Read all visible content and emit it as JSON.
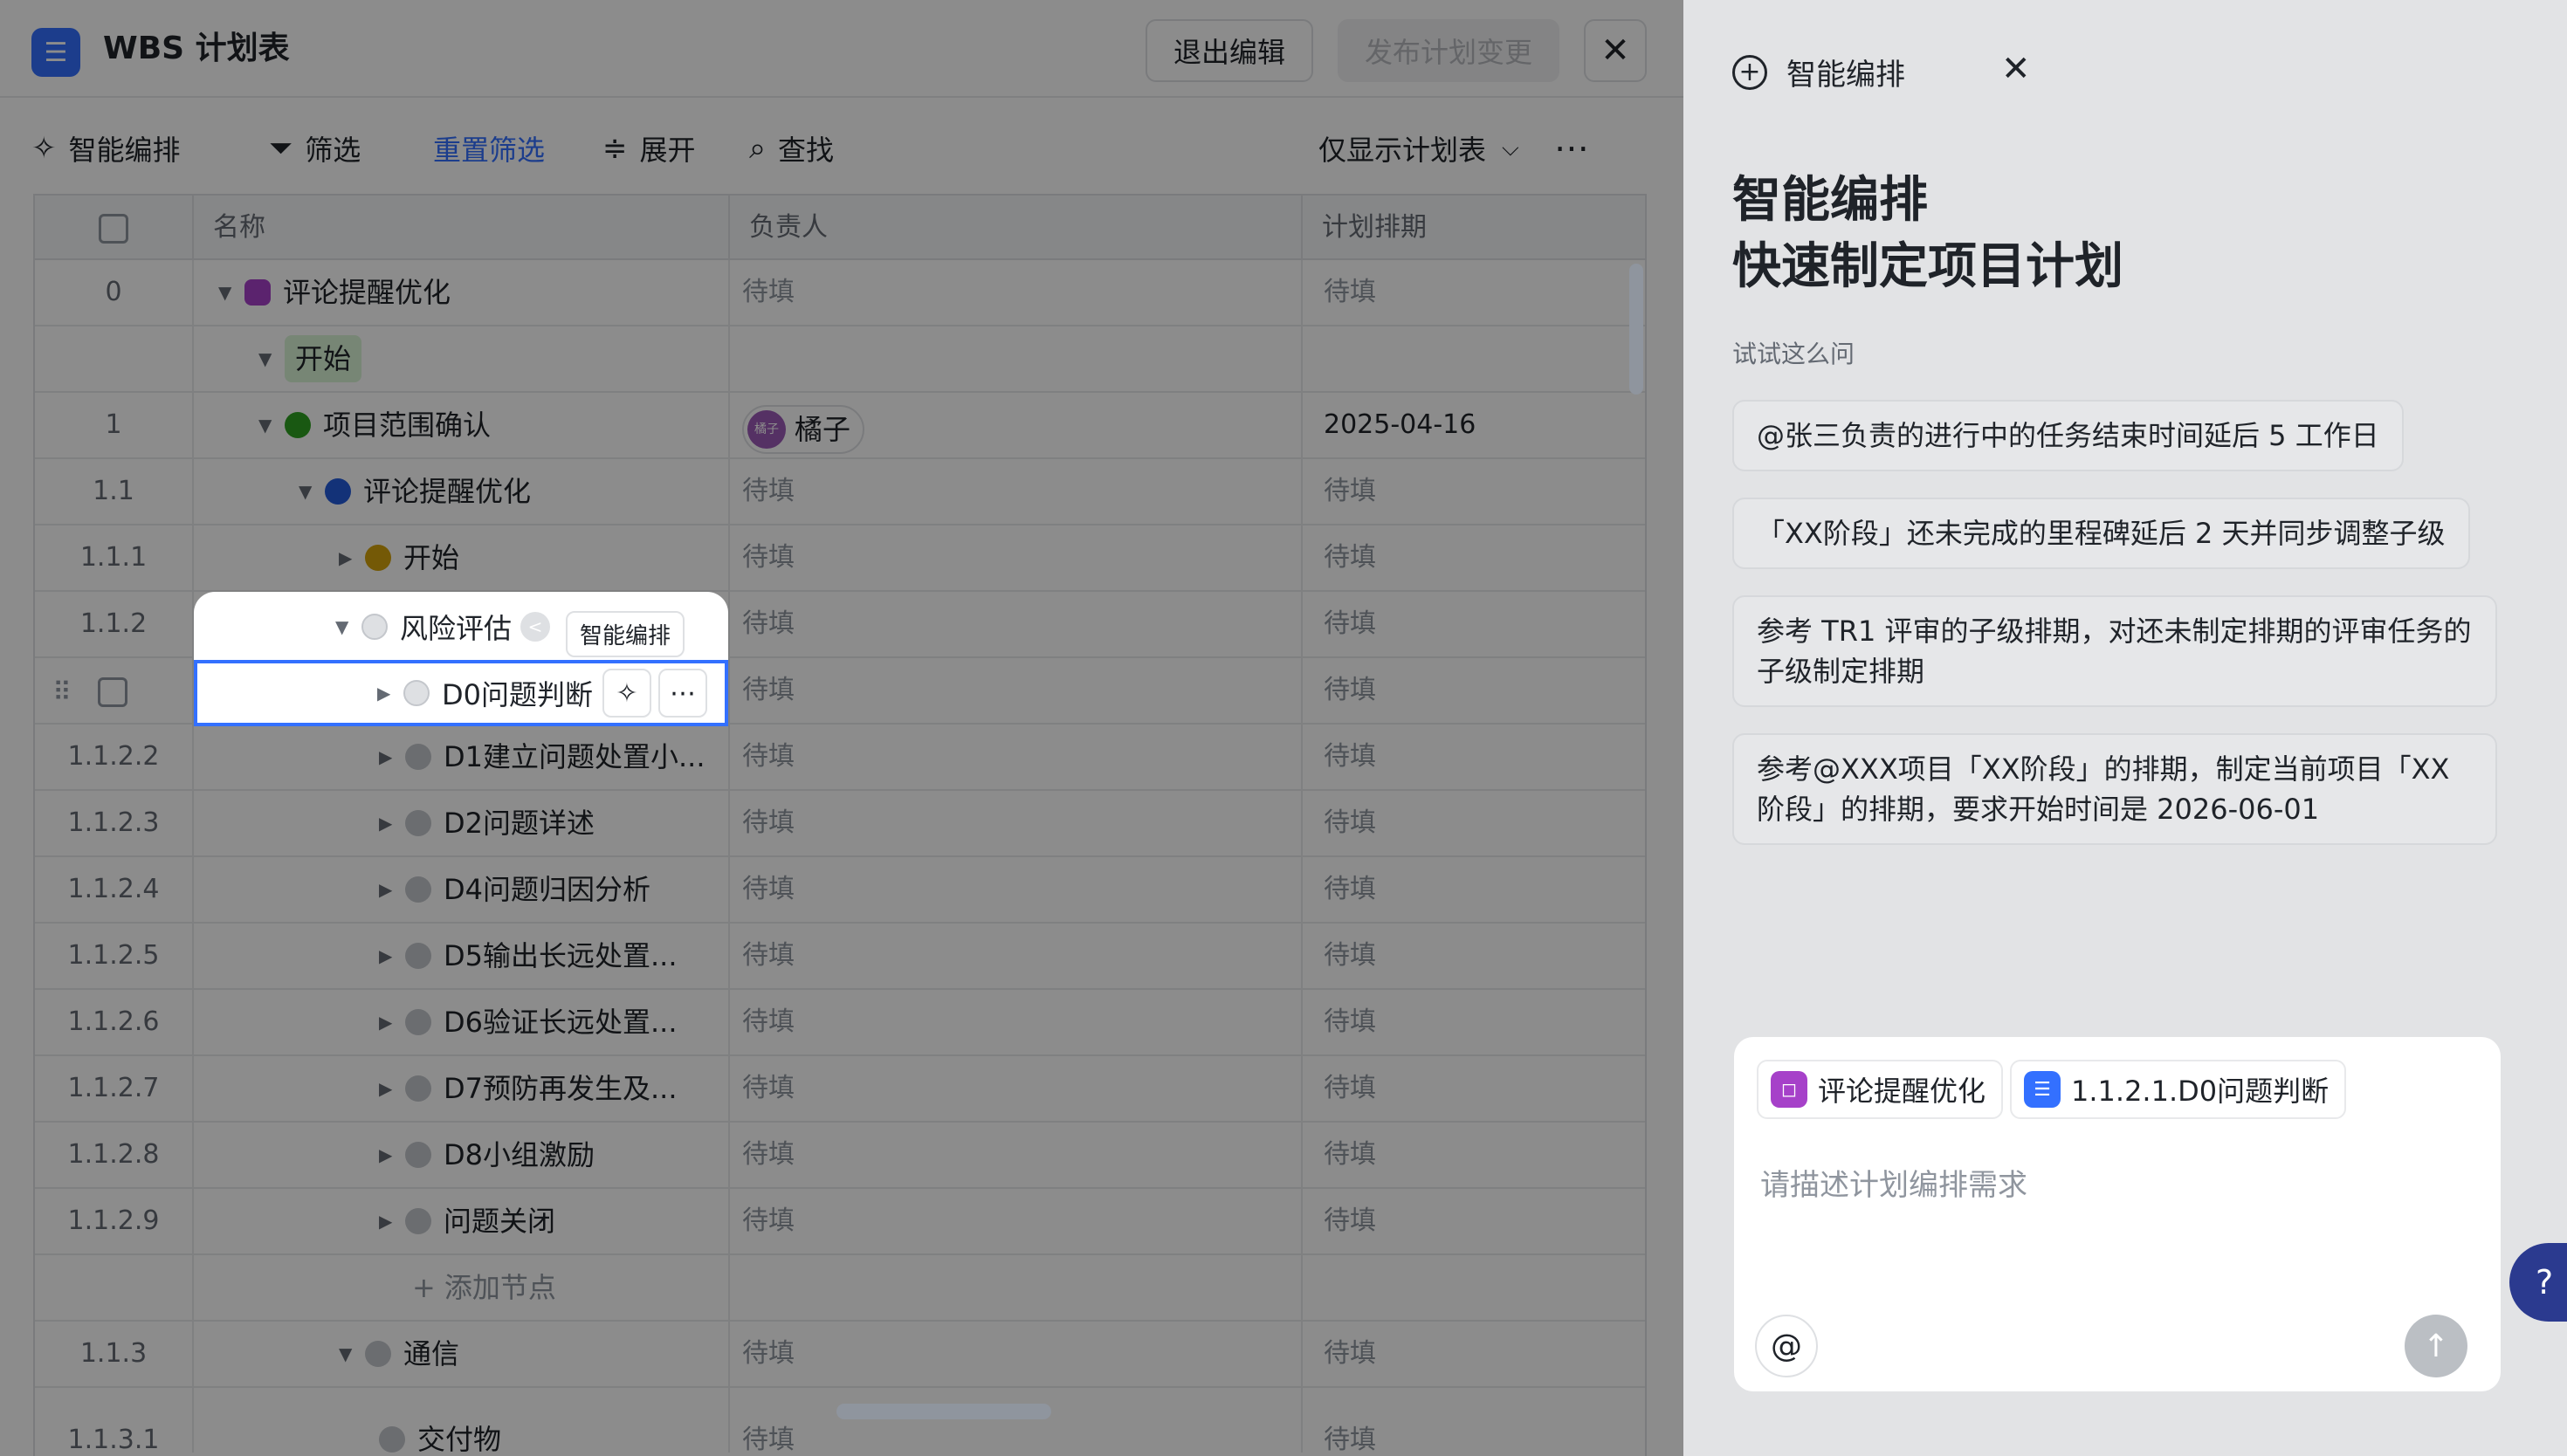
{
  "header": {
    "title": "WBS 计划表",
    "exit_label": "退出编辑",
    "publish_label": "发布计划变更",
    "close_glyph": "✕"
  },
  "toolbar": {
    "smart": "智能编排",
    "filter": "筛选",
    "reset": "重置筛选",
    "expand": "展开",
    "find": "查找",
    "view": "仅显示计划表"
  },
  "table": {
    "columns": [
      "名称",
      "负责人",
      "计划排期"
    ],
    "rows": [
      {
        "no": "0",
        "name": "评论提醒优化",
        "owner": "待填",
        "plan": "待填"
      },
      {
        "no": "",
        "name": "开始",
        "owner": "",
        "plan": ""
      },
      {
        "no": "1",
        "name": "项目范围确认",
        "owner": "橘子",
        "owner_avatar": "橘子",
        "plan": "2025-04-16"
      },
      {
        "no": "1.1",
        "name": "评论提醒优化",
        "owner": "待填",
        "plan": "待填"
      },
      {
        "no": "1.1.1",
        "name": "开始",
        "owner": "待填",
        "plan": "待填"
      },
      {
        "no": "1.1.2",
        "name": "风险评估",
        "owner": "待填",
        "plan": "待填"
      },
      {
        "no": "",
        "name": "D0问题判断",
        "owner": "待填",
        "plan": "待填"
      },
      {
        "no": "1.1.2.2",
        "name": "D1建立问题处置小...",
        "owner": "待填",
        "plan": "待填"
      },
      {
        "no": "1.1.2.3",
        "name": "D2问题详述",
        "owner": "待填",
        "plan": "待填"
      },
      {
        "no": "1.1.2.4",
        "name": "D4问题归因分析",
        "owner": "待填",
        "plan": "待填"
      },
      {
        "no": "1.1.2.5",
        "name": "D5输出长远处置...",
        "owner": "待填",
        "plan": "待填"
      },
      {
        "no": "1.1.2.6",
        "name": "D6验证长远处置...",
        "owner": "待填",
        "plan": "待填"
      },
      {
        "no": "1.1.2.7",
        "name": "D7预防再发生及...",
        "owner": "待填",
        "plan": "待填"
      },
      {
        "no": "1.1.2.8",
        "name": "D8小组激励",
        "owner": "待填",
        "plan": "待填"
      },
      {
        "no": "1.1.2.9",
        "name": "问题关闭",
        "owner": "待填",
        "plan": "待填"
      },
      {
        "no": "",
        "name": "添加节点",
        "owner": "",
        "plan": ""
      },
      {
        "no": "1.1.3",
        "name": "通信",
        "owner": "待填",
        "plan": "待填"
      },
      {
        "no": "1.1.3.1",
        "name": "交付物",
        "owner": "待填",
        "plan": "待填"
      }
    ],
    "tooltip": "智能编排"
  },
  "panel": {
    "top_label": "智能编排",
    "heading_line1": "智能编排",
    "heading_line2": "快速制定项目计划",
    "hint": "试试这么问",
    "suggestions": [
      "@张三负责的进行中的任务结束时间延后 5 工作日",
      "「XX阶段」还未完成的里程碑延后 2 天并同步调整子级",
      "参考 TR1 评审的子级排期，对还未制定排期的评审任务的子级制定排期",
      "参考@XXX项目「XX阶段」的排期，制定当前项目「XX阶段」的排期，要求开始时间是 2026-06-01"
    ],
    "chips": [
      "评论提醒优化",
      "1.1.2.1.D0问题判断"
    ],
    "input_placeholder": "请描述计划编排需求"
  },
  "colors": {
    "accent": "#3370ff",
    "dot_purple": "#a641c9",
    "dot_green": "#2ea121",
    "dot_blue": "#245bdb",
    "dot_yellow": "#d4a20b"
  }
}
